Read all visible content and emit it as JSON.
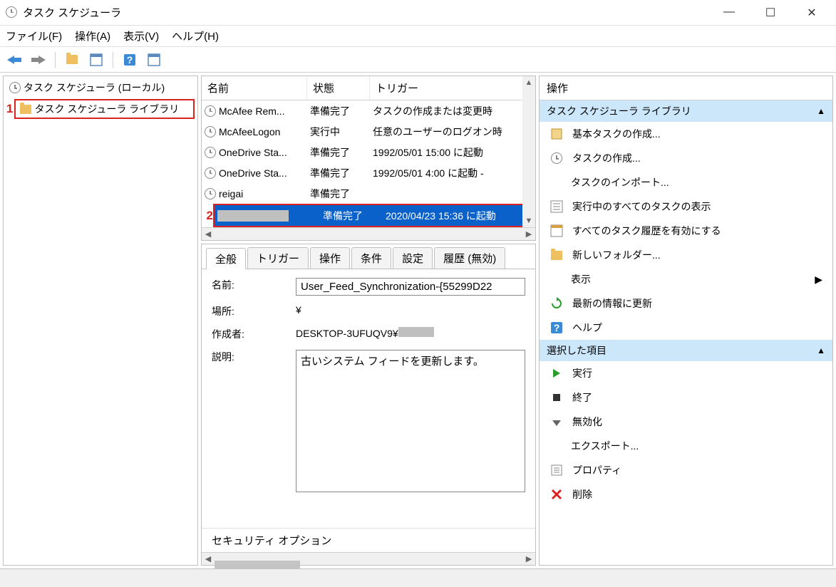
{
  "title": "タスク スケジューラ",
  "menu": {
    "file": "ファイル(F)",
    "action": "操作(A)",
    "view": "表示(V)",
    "help": "ヘルプ(H)"
  },
  "tree": {
    "root": "タスク スケジューラ (ローカル)",
    "library": "タスク スケジューラ ライブラリ"
  },
  "annotation1": "1",
  "annotation2": "2",
  "task_columns": {
    "name": "名前",
    "state": "状態",
    "trigger": "トリガー"
  },
  "tasks": [
    {
      "name": "McAfee Rem...",
      "state": "準備完了",
      "trigger": "タスクの作成または変更時"
    },
    {
      "name": "McAfeeLogon",
      "state": "実行中",
      "trigger": "任意のユーザーのログオン時"
    },
    {
      "name": "OneDrive Sta...",
      "state": "準備完了",
      "trigger": "1992/05/01 15:00 に起動"
    },
    {
      "name": "OneDrive Sta...",
      "state": "準備完了",
      "trigger": "1992/05/01 4:00 に起動 -"
    },
    {
      "name": "reigai",
      "state": "準備完了",
      "trigger": ""
    },
    {
      "name": "",
      "state": "準備完了",
      "trigger": "2020/04/23 15:36 に起動"
    }
  ],
  "tabs": {
    "general": "全般",
    "triggers": "トリガー",
    "actions": "操作",
    "conditions": "条件",
    "settings": "設定",
    "history": "履歴 (無効)"
  },
  "detail": {
    "name_label": "名前:",
    "name_value": "User_Feed_Synchronization-{55299D22",
    "location_label": "場所:",
    "location_value": "¥",
    "author_label": "作成者:",
    "author_value": "DESKTOP-3UFUQV9¥",
    "desc_label": "説明:",
    "desc_value": "古いシステム フィードを更新します。",
    "security_options": "セキュリティ オプション"
  },
  "actions": {
    "title": "操作",
    "library_section": "タスク スケジューラ ライブラリ",
    "selected_section": "選択した項目",
    "items": {
      "create_basic": "基本タスクの作成...",
      "create_task": "タスクの作成...",
      "import": "タスクのインポート...",
      "show_running": "実行中のすべてのタスクの表示",
      "enable_history": "すべてのタスク履歴を有効にする",
      "new_folder": "新しいフォルダー...",
      "view": "表示",
      "refresh": "最新の情報に更新",
      "help": "ヘルプ"
    },
    "sel_items": {
      "run": "実行",
      "end": "終了",
      "disable": "無効化",
      "export": "エクスポート...",
      "properties": "プロパティ",
      "delete": "削除"
    }
  }
}
